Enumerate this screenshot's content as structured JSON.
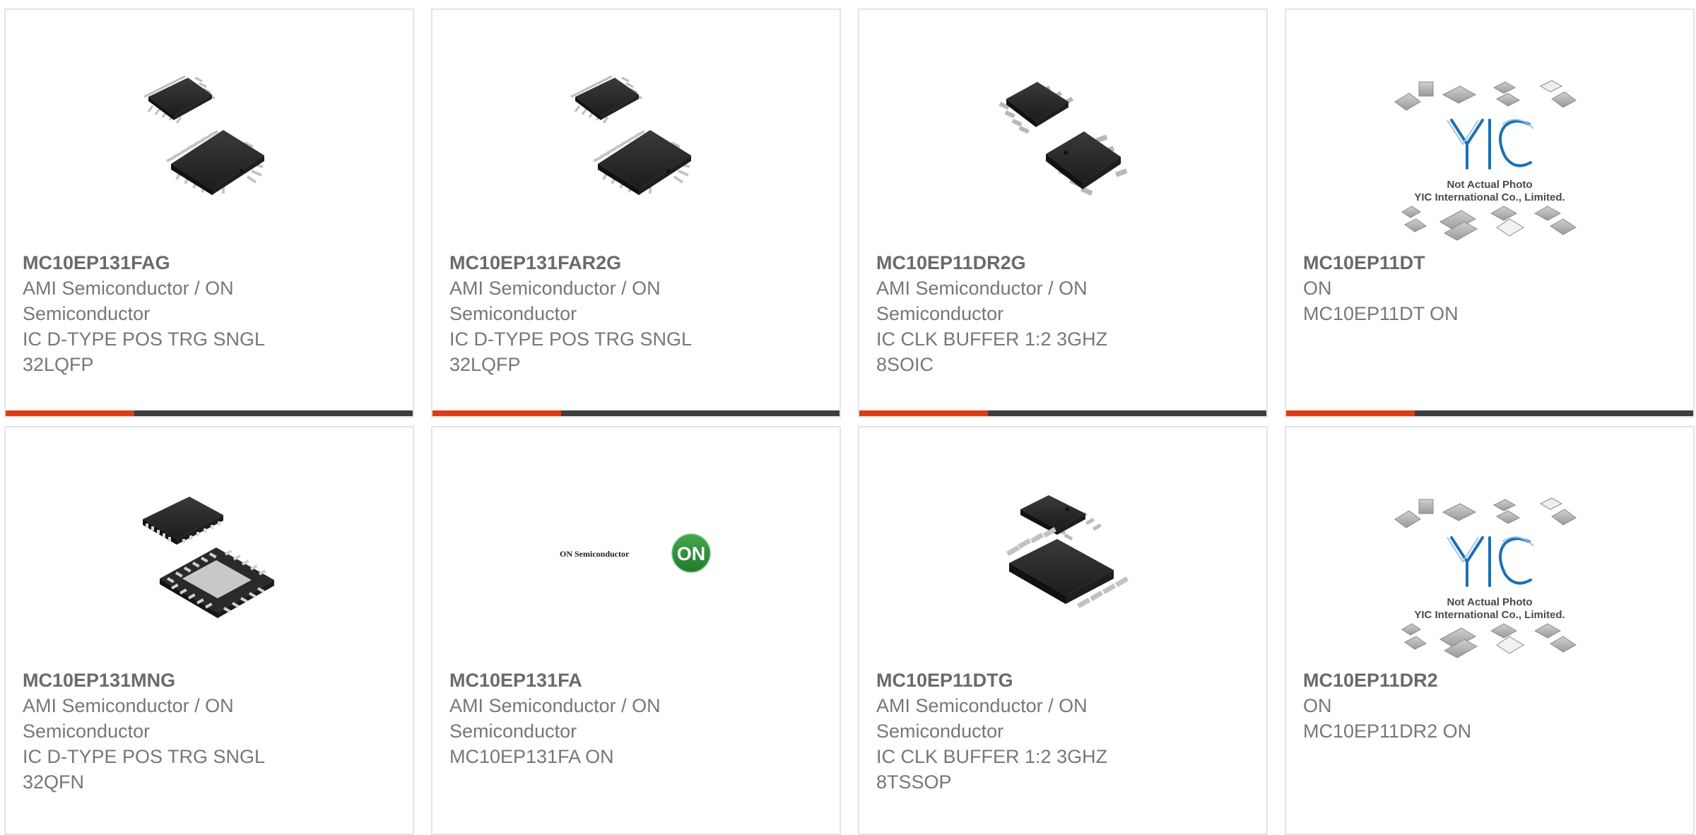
{
  "colors": {
    "accent_bar": "#e23a12",
    "dark_bar": "#3d3d3d",
    "card_border": "#e3e3e3",
    "text": "#777777",
    "logo_green": "#2f8f3a",
    "yic_blue": "#1d6fb5"
  },
  "products": [
    {
      "part_number": "MC10EP131FAG",
      "manufacturer_line1": "AMI Semiconductor / ON",
      "manufacturer_line2": "Semiconductor",
      "description_line1": "IC D-TYPE POS TRG SNGL",
      "description_line2": "32LQFP",
      "image": "lqfp-chip-photo"
    },
    {
      "part_number": "MC10EP131FAR2G",
      "manufacturer_line1": "AMI Semiconductor / ON",
      "manufacturer_line2": "Semiconductor",
      "description_line1": "IC D-TYPE POS TRG SNGL",
      "description_line2": "32LQFP",
      "image": "lqfp-chip-photo"
    },
    {
      "part_number": "MC10EP11DR2G",
      "manufacturer_line1": "AMI Semiconductor / ON",
      "manufacturer_line2": "Semiconductor",
      "description_line1": "IC CLK BUFFER 1:2 3GHZ",
      "description_line2": "8SOIC",
      "image": "soic-chip-photo"
    },
    {
      "part_number": "MC10EP11DT",
      "manufacturer_line1": "ON",
      "manufacturer_line2": "MC10EP11DT ON",
      "description_line1": "",
      "description_line2": "",
      "image": "not-actual-photo",
      "placeholder_line1": "Not Actual Photo",
      "placeholder_line2": "YIC International Co., Limited."
    },
    {
      "part_number": "MC10EP131MNG",
      "manufacturer_line1": "AMI Semiconductor / ON",
      "manufacturer_line2": "Semiconductor",
      "description_line1": "IC D-TYPE POS TRG SNGL",
      "description_line2": "32QFN",
      "image": "qfn-chip-photo"
    },
    {
      "part_number": "MC10EP131FA",
      "manufacturer_line1": "AMI Semiconductor / ON",
      "manufacturer_line2": "Semiconductor",
      "description_line1": "MC10EP131FA ON",
      "description_line2": "",
      "image": "on-semiconductor-logo",
      "logo_text": "ON Semiconductor",
      "logo_mark": "ON"
    },
    {
      "part_number": "MC10EP11DTG",
      "manufacturer_line1": "AMI Semiconductor / ON",
      "manufacturer_line2": "Semiconductor",
      "description_line1": "IC CLK BUFFER 1:2 3GHZ",
      "description_line2": "8TSSOP",
      "image": "tssop-chip-photo"
    },
    {
      "part_number": "MC10EP11DR2",
      "manufacturer_line1": "ON",
      "manufacturer_line2": "MC10EP11DR2 ON",
      "description_line1": "",
      "description_line2": "",
      "image": "not-actual-photo",
      "placeholder_line1": "Not Actual Photo",
      "placeholder_line2": "YIC International Co., Limited."
    }
  ]
}
